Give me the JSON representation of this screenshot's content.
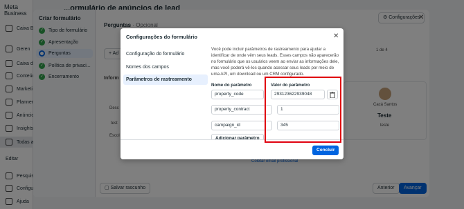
{
  "app": {
    "logo": "Meta",
    "logo_sub": "Business",
    "title": "...ormulário de anúncios de lead",
    "nav": [
      {
        "label": "Criar formulário",
        "icon": "plus-icon"
      },
      {
        "label": "Caixa Ben",
        "icon": "home-icon"
      },
      {
        "label": "Geren",
        "icon": "grid-icon"
      },
      {
        "label": "Caixa d",
        "icon": "inbox-icon"
      },
      {
        "label": "Conteúdo",
        "icon": "content-icon"
      },
      {
        "label": "Marketi",
        "icon": "megaphone-icon"
      },
      {
        "label": "Planner",
        "icon": "calendar-icon"
      },
      {
        "label": "Anúncio",
        "icon": "ads-icon"
      },
      {
        "label": "Insights",
        "icon": "chart-icon"
      },
      {
        "label": "Todas as",
        "icon": "menu-icon"
      },
      {
        "label": "Editar",
        "icon": "edit-icon"
      },
      {
        "label": "Pesquisar",
        "icon": "search-icon"
      },
      {
        "label": "Configu",
        "icon": "gear-icon"
      },
      {
        "label": "Ajuda",
        "icon": "help-icon"
      }
    ]
  },
  "creator": {
    "steps_title": "Criar formulário",
    "steps": [
      {
        "label": "Tipo de formulário",
        "state": "done"
      },
      {
        "label": "Apresentação",
        "state": "done"
      },
      {
        "label": "Perguntas",
        "state": "current"
      },
      {
        "label": "Política de privaci...",
        "state": "done"
      },
      {
        "label": "Encerramento",
        "state": "done"
      }
    ],
    "section_title": "Perguntas",
    "section_optional": "· Opcional",
    "config_button": "Configurações",
    "add_label": "+ Ad",
    "info_label": "Inform",
    "desc_label": "Desc",
    "test_field": "test",
    "choose_label": "Escol",
    "pager": "1 de 4",
    "preview_name": "Cacá Santos",
    "preview_title": "Teste",
    "preview_sub": "teste",
    "email_link": "Coletar email profissional",
    "save_draft": "Salvar rascunho",
    "prev": "Anterior",
    "next": "Avançar"
  },
  "dialog": {
    "title": "Configurações do formulário",
    "menu": [
      {
        "label": "Configuração do formulário",
        "active": false
      },
      {
        "label": "Nomes dos campos",
        "active": false
      },
      {
        "label": "Parâmetros de rastreamento",
        "active": true
      }
    ],
    "description": "Você pode incluir parâmetros de rastreamento para ajudar a identificar de onde vêm seus leads. Esses campos não aparecerão no formulário que os usuários veem ao enviar as informações dele, mas você poderá vê-los quando acessar seus leads por meio de uma API, um download ou um CRM configurado.",
    "param_name_header": "Nome do parâmetro",
    "param_value_header": "Valor do parâmetro",
    "params": [
      {
        "name": "property_code",
        "value": "293123622939048"
      },
      {
        "name": "property_contract",
        "value": "1"
      },
      {
        "name": "campaign_id",
        "value": "345"
      }
    ],
    "add_param": "Adicionar parâmetro",
    "conclude": "Concluir"
  }
}
